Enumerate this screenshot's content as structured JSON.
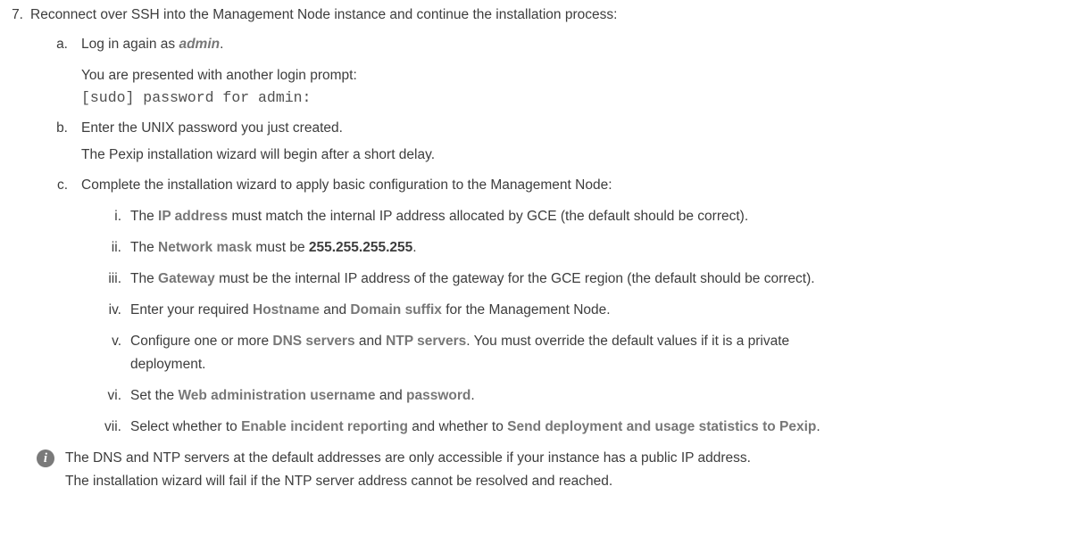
{
  "step7": {
    "number": "7.",
    "text": "Reconnect over SSH into the Management Node instance and continue the installation process:"
  },
  "a": {
    "marker": "a.",
    "prefix": "Log in again as ",
    "user": "admin",
    "suffix": ".",
    "note": "You are presented with another login prompt:",
    "prompt": "[sudo] password for admin:"
  },
  "b": {
    "marker": "b.",
    "text": "Enter the UNIX password you just created.",
    "note": "The Pexip installation wizard will begin after a short delay."
  },
  "c": {
    "marker": "c.",
    "text": "Complete the installation wizard to apply basic configuration to the Management Node:"
  },
  "items": {
    "i": {
      "marker": "i.",
      "pre": "The ",
      "field": "IP address",
      "post": " must match the internal IP address allocated by GCE (the default should be correct)."
    },
    "ii": {
      "marker": "ii.",
      "pre": "The ",
      "field": "Network mask",
      "mid": " must be ",
      "value": "255.255.255.255",
      "post": "."
    },
    "iii": {
      "marker": "iii.",
      "pre": "The ",
      "field": "Gateway",
      "post": " must be the internal IP address of the gateway for the GCE region (the default should be correct)."
    },
    "iv": {
      "marker": "iv.",
      "pre": "Enter your required ",
      "field1": "Hostname",
      "mid": " and ",
      "field2": "Domain suffix",
      "post": " for the Management Node."
    },
    "v": {
      "marker": "v.",
      "pre": "Configure one or more ",
      "field1": "DNS servers",
      "mid": " and ",
      "field2": "NTP servers",
      "post": ". You must override the default values if it is a private",
      "cont": "deployment."
    },
    "vi": {
      "marker": "vi.",
      "pre": "Set the ",
      "field1": "Web administration username",
      "mid": " and ",
      "field2": "password",
      "post": "."
    },
    "vii": {
      "marker": "vii.",
      "pre": "Select whether to ",
      "field1": "Enable incident reporting",
      "mid": " and whether to ",
      "field2": "Send deployment and usage statistics to Pexip",
      "post": "."
    }
  },
  "info": {
    "icon": "info-icon",
    "line1": "The DNS and NTP servers at the default addresses are only accessible if your instance has a public IP address.",
    "line2": "The installation wizard will fail if the NTP server address cannot be resolved and reached."
  }
}
